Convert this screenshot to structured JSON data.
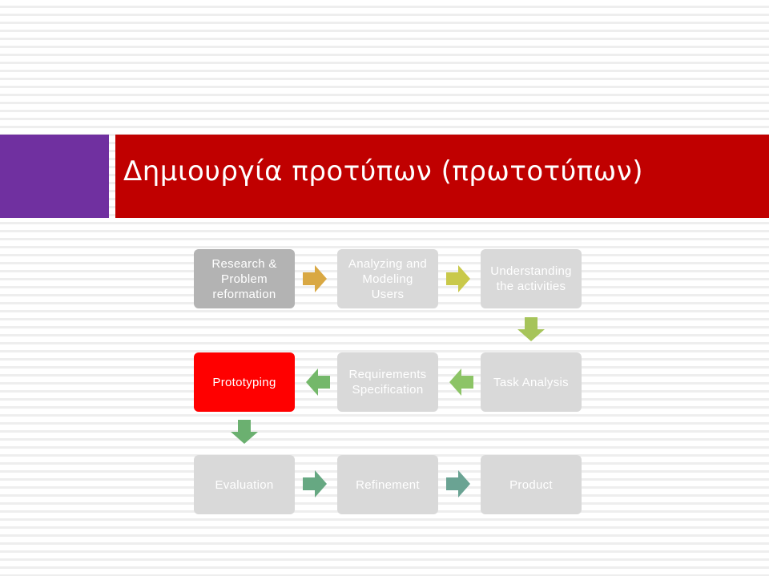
{
  "slide": {
    "title": "Δημιουργία προτύπων (πρωτοτύπων)",
    "colors": {
      "title_bar": "#c00000",
      "accent_block": "#7030a0",
      "node_default": "#d9d9d9",
      "node_first": "#b3b3b3",
      "node_active": "#ff0000"
    }
  },
  "diagram": {
    "nodes": [
      {
        "id": "research",
        "label": "Research &\nProblem\nreformation"
      },
      {
        "id": "analyzing",
        "label": "Analyzing and\nModeling\nUsers"
      },
      {
        "id": "understanding",
        "label": "Understanding\nthe activities"
      },
      {
        "id": "task-analysis",
        "label": "Task Analysis"
      },
      {
        "id": "requirements",
        "label": "Requirements\nSpecification"
      },
      {
        "id": "prototyping",
        "label": "Prototyping"
      },
      {
        "id": "evaluation",
        "label": "Evaluation"
      },
      {
        "id": "refinement",
        "label": "Refinement"
      },
      {
        "id": "product",
        "label": "Product"
      }
    ],
    "arrows": [
      {
        "from": "research",
        "to": "analyzing",
        "direction": "right",
        "color": "#d9a843"
      },
      {
        "from": "analyzing",
        "to": "understanding",
        "direction": "right",
        "color": "#c9c94a"
      },
      {
        "from": "understanding",
        "to": "task-analysis",
        "direction": "down",
        "color": "#a6c45a"
      },
      {
        "from": "task-analysis",
        "to": "requirements",
        "direction": "left",
        "color": "#8cc466"
      },
      {
        "from": "requirements",
        "to": "prototyping",
        "direction": "left",
        "color": "#74b86a"
      },
      {
        "from": "prototyping",
        "to": "evaluation",
        "direction": "down",
        "color": "#6bb070"
      },
      {
        "from": "evaluation",
        "to": "refinement",
        "direction": "right",
        "color": "#66a882"
      },
      {
        "from": "refinement",
        "to": "product",
        "direction": "right",
        "color": "#6aa393"
      }
    ]
  }
}
